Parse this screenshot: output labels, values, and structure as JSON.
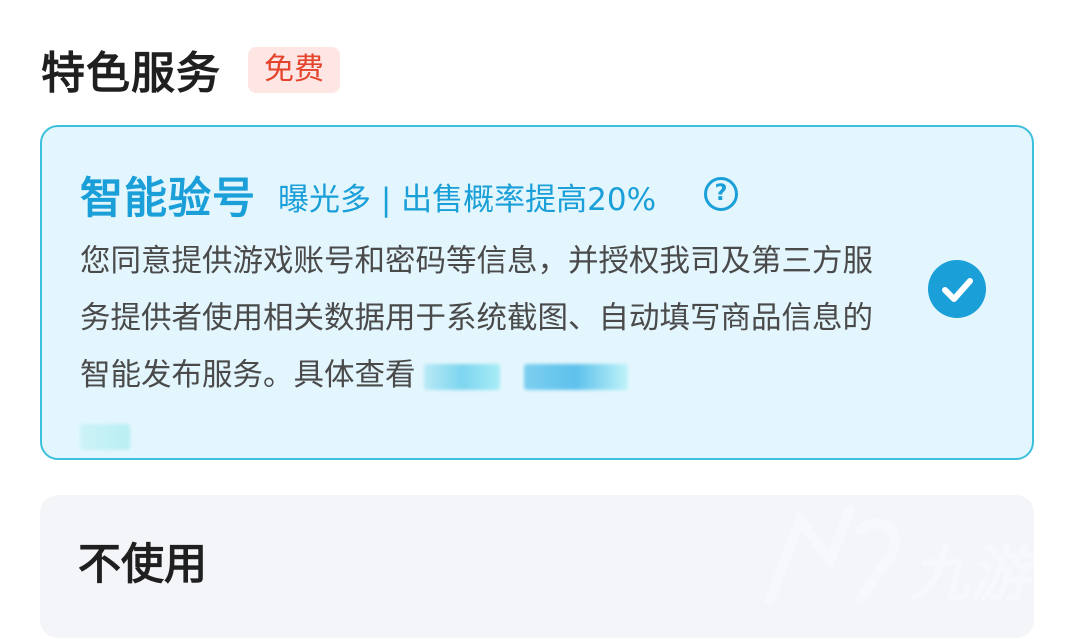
{
  "section": {
    "title": "特色服务",
    "badge": "免费"
  },
  "selected_option": {
    "title": "智能验号",
    "tagline": "曝光多 | 出售概率提高20%",
    "help_icon": "question-circle-icon",
    "description": "您同意提供游戏账号和密码等信息，并授权我司及第三方服务提供者使用相关数据用于系统截图、自动填写商品信息的智能发布服务。具体查看",
    "selected": true,
    "check_icon": "check-circle-icon"
  },
  "other_option": {
    "label": "不使用"
  },
  "colors": {
    "accent": "#1a9fd8",
    "selected_bg": "#e3f6fd",
    "selected_border": "#3dc0dd",
    "badge_bg": "#fde6e3",
    "badge_text": "#e5432b",
    "option_bg": "#f4f5f9"
  },
  "watermark": {
    "text": "九游",
    "icon": "9game-logo-icon"
  }
}
